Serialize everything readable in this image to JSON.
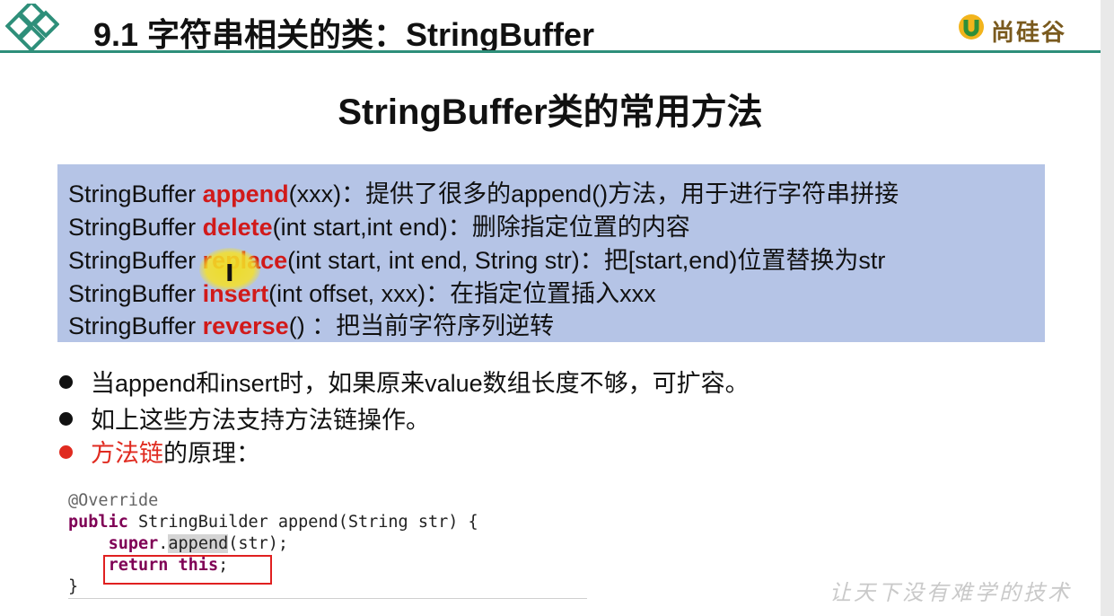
{
  "header": {
    "title": "9.1 字符串相关的类：StringBuffer",
    "brand_text": "尚硅谷",
    "accent_color": "#2e8f7a"
  },
  "subtitle": "StringBuffer类的常用方法",
  "methods": [
    {
      "prefix": "StringBuffer ",
      "keyword": "append",
      "rest": "(xxx)：提供了很多的append()方法，用于进行字符串拼接"
    },
    {
      "prefix": "StringBuffer ",
      "keyword": "delete",
      "rest": "(int start,int end)：删除指定位置的内容"
    },
    {
      "prefix": "StringBuffer ",
      "keyword": "replace",
      "rest": "(int start, int end, String str)：把[start,end)位置替换为str"
    },
    {
      "prefix": "StringBuffer ",
      "keyword": "insert",
      "rest": "(int offset, xxx)：在指定位置插入xxx"
    },
    {
      "prefix": "StringBuffer ",
      "keyword": "reverse",
      "rest": "() ：把当前字符序列逆转"
    }
  ],
  "bullets": [
    {
      "text": "当append和insert时，如果原来value数组长度不够，可扩容。"
    },
    {
      "text": "如上这些方法支持方法链操作。"
    },
    {
      "red_text": "方法链",
      "text": "的原理："
    }
  ],
  "code": {
    "line1": "@Override",
    "line2_kw": "public",
    "line2_rest": " StringBuilder append(String str) {",
    "line3_indent": "    ",
    "line3_kw": "super",
    "line3_dot": ".",
    "line3_method": "append",
    "line3_rest": "(str);",
    "line4_indent": "    ",
    "line4_kw1": "return",
    "line4_space": " ",
    "line4_kw2": "this",
    "line4_rest": ";",
    "line5": "}"
  },
  "slogan": "让天下没有难学的技术",
  "colors": {
    "method_box_bg": "#b5c4e6",
    "keyword_red": "#d11a1a",
    "bullet_red": "#e02b20"
  }
}
